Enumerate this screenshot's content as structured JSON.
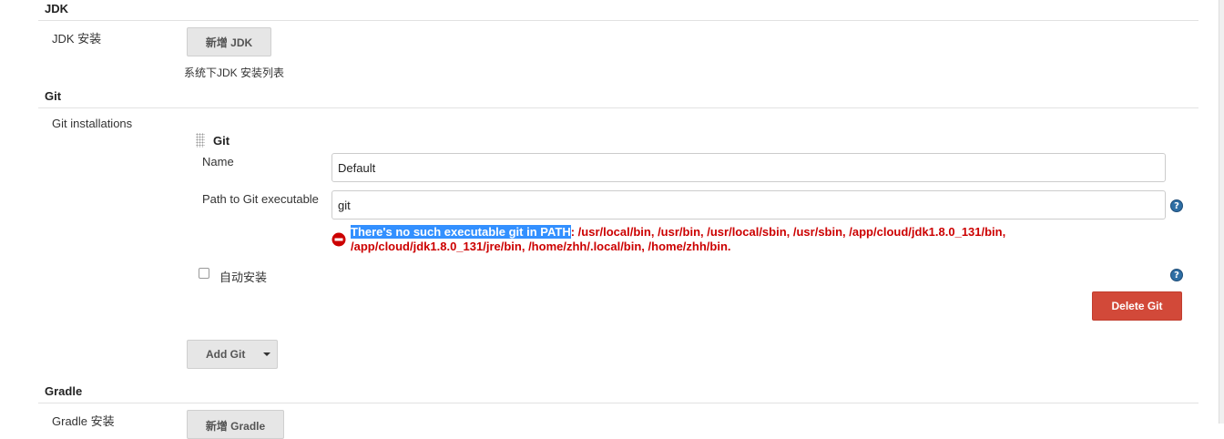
{
  "jdk": {
    "section_title": "JDK",
    "install_label": "JDK 安装",
    "add_button": "新增 JDK",
    "list_hint": "系统下JDK 安装列表"
  },
  "git": {
    "section_title": "Git",
    "installations_label": "Git installations",
    "item_header": "Git",
    "name_label": "Name",
    "name_value": "Default",
    "path_label": "Path to Git executable",
    "path_value": "git",
    "error_highlight": "There's no such executable git in PATH",
    "error_line1_rest": ": /usr/local/bin, /usr/bin, /usr/local/sbin, /usr/sbin, /app/cloud/jdk1.8.0_131/bin,",
    "error_line2": "/app/cloud/jdk1.8.0_131/jre/bin, /home/zhh/.local/bin, /home/zhh/bin.",
    "auto_install_label": "自动安装",
    "delete_button": "Delete Git",
    "add_button": "Add Git"
  },
  "gradle": {
    "section_title": "Gradle",
    "install_label": "Gradle 安装",
    "add_button": "新增 Gradle"
  },
  "colors": {
    "delete_button_bg": "#d24939",
    "error_text": "#cc0000",
    "help_icon": "#2e6ea4",
    "selection": "#3390ff"
  },
  "icons": {
    "help": "question-circle-icon",
    "error": "no-entry-icon",
    "dropdown": "caret-down-icon",
    "drag": "drag-handle-icon"
  }
}
